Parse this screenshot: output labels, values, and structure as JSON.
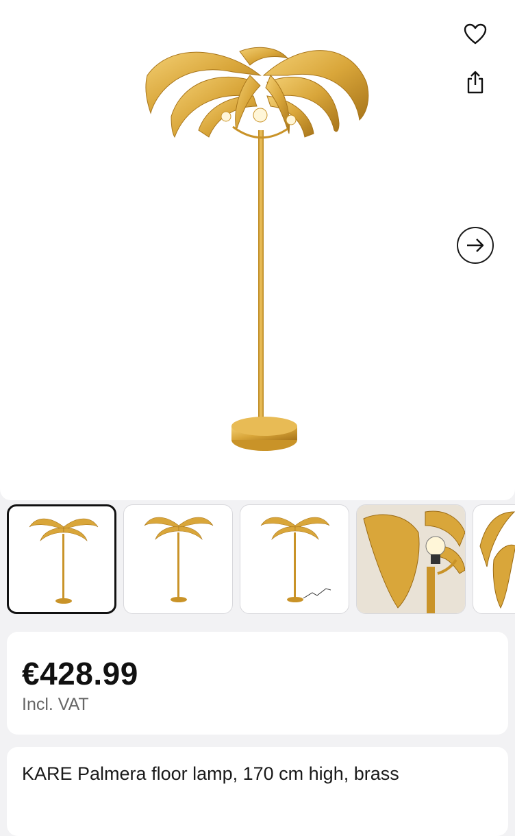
{
  "product": {
    "price": "€428.99",
    "vat_note": "Incl. VAT",
    "title": "KARE Palmera floor lamp, 170 cm high, brass"
  },
  "gallery": {
    "active_index": 0,
    "thumbnail_count_visible": 5
  },
  "icons": {
    "favorite": "heart-icon",
    "share": "share-icon",
    "next_image": "arrow-right-icon"
  },
  "colors": {
    "brass": "#d9a63a",
    "brass_dark": "#b07d1f",
    "background": "#f2f2f4",
    "text": "#1a1a1a",
    "muted": "#666666"
  }
}
